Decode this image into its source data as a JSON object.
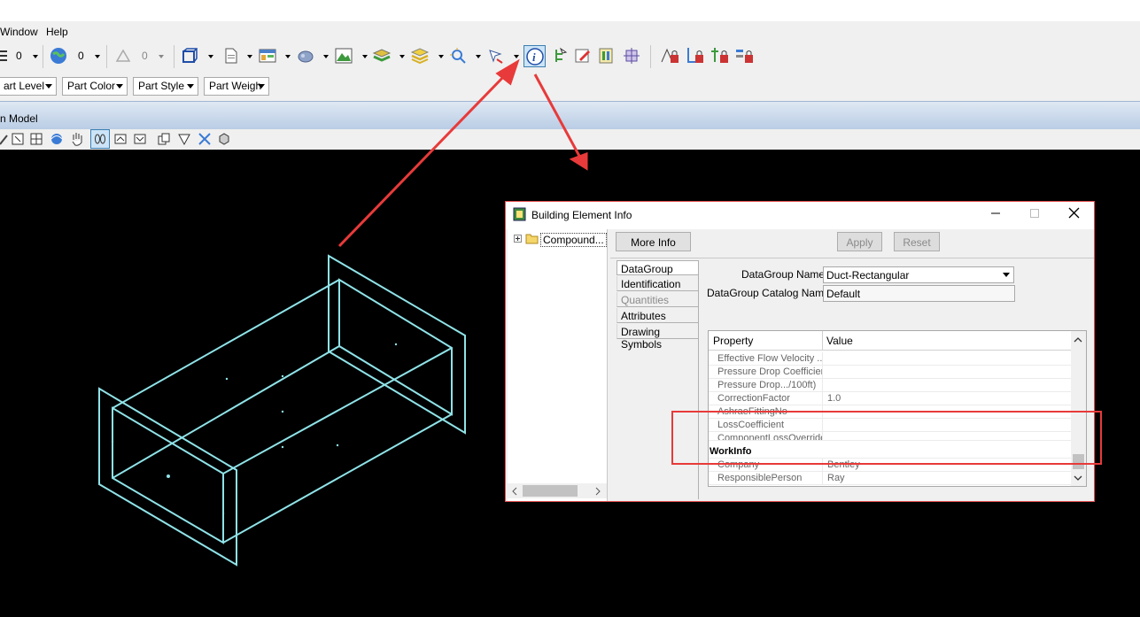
{
  "menu": {
    "window": "Window",
    "help": "Help"
  },
  "toolbar": {
    "level_value": "0",
    "color_value": "0",
    "weight_value": "0",
    "part_level": "art Level",
    "part_color": "Part Color",
    "part_style": "Part Style",
    "part_weight": "Part Weigh"
  },
  "view": {
    "title": "n Model"
  },
  "dialog": {
    "title": "Building Element Info",
    "tree_node": "Compound...",
    "more_info": "More Info",
    "apply": "Apply",
    "reset": "Reset",
    "tabs": [
      "DataGroup Data",
      "Identification",
      "Quantities",
      "Attributes",
      "Drawing Symbols"
    ],
    "datagroup_name_label": "DataGroup Name:",
    "datagroup_name_value": "Duct-Rectangular",
    "catalog_name_label": "DataGroup Catalog Name:",
    "catalog_name_value": "Default",
    "grid_headers": {
      "property": "Property",
      "value": "Value"
    },
    "rows": [
      {
        "name": "Effective Flow Velocity ...",
        "value": ""
      },
      {
        "name": "Pressure Drop Coefficient",
        "value": ""
      },
      {
        "name": "Pressure Drop.../100ft)",
        "value": ""
      },
      {
        "name": "CorrectionFactor",
        "value": "1.0"
      },
      {
        "name": "AshraeFittingNo",
        "value": ""
      },
      {
        "name": "LossCoefficient",
        "value": ""
      },
      {
        "name": "ComponentLossOverride",
        "value": ""
      }
    ],
    "group_header": "WorkInfo",
    "workinfo_rows": [
      {
        "name": "Company",
        "value": "Bentley"
      },
      {
        "name": "ResponsiblePerson",
        "value": "Ray"
      }
    ]
  }
}
